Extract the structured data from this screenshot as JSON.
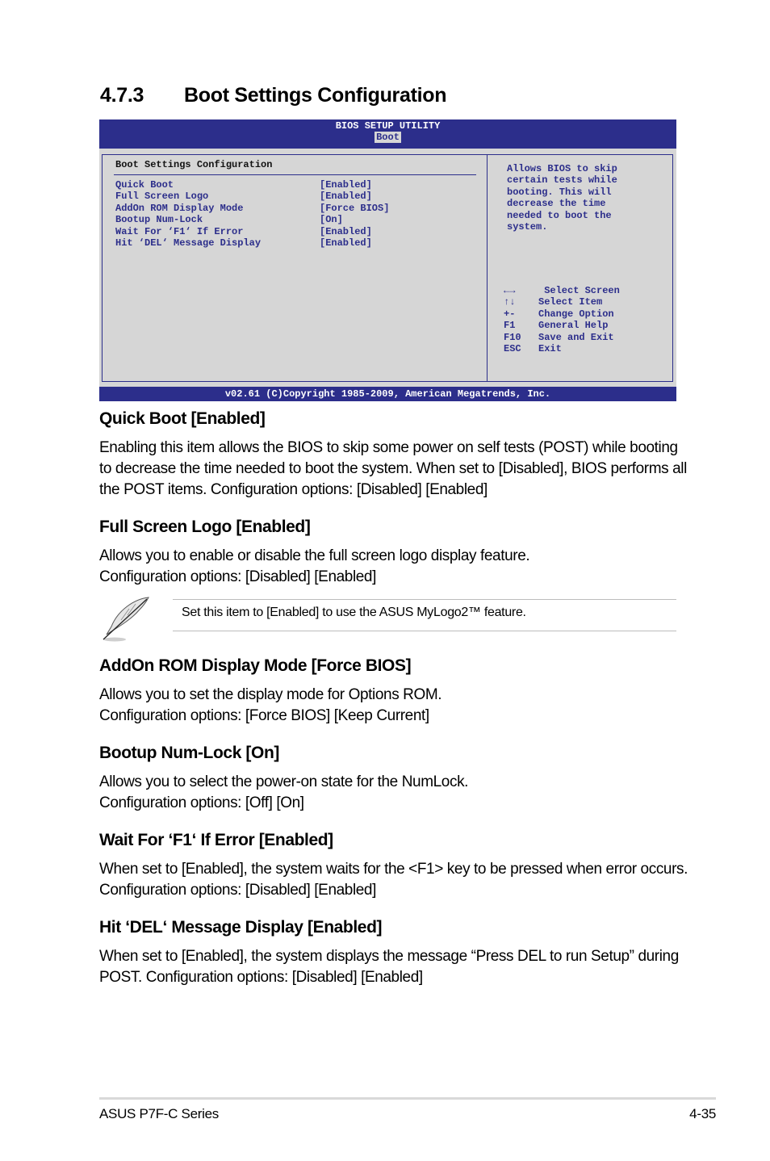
{
  "section": {
    "number": "4.7.3",
    "title": "Boot Settings Configuration"
  },
  "bios": {
    "header_title": "BIOS SETUP UTILITY",
    "active_tab": "Boot",
    "panel_title": "Boot Settings Configuration",
    "items": [
      {
        "label": "Quick Boot",
        "value": "[Enabled]"
      },
      {
        "label": "Full Screen Logo",
        "value": "[Enabled]"
      },
      {
        "label": "AddOn ROM Display Mode",
        "value": "[Force BIOS]"
      },
      {
        "label": "Bootup Num-Lock",
        "value": "[On]"
      },
      {
        "label": "Wait For ‘F1‘ If Error",
        "value": "[Enabled]"
      },
      {
        "label": "Hit ‘DEL‘ Message Display",
        "value": "[Enabled]"
      }
    ],
    "help_text": "Allows BIOS to skip\ncertain tests while\nbooting. This will\ndecrease the time\nneeded to boot the\nsystem.",
    "keys": [
      {
        "key": "←→",
        "action": " Select Screen"
      },
      {
        "key": "↑↓",
        "action": "Select Item"
      },
      {
        "key": "+-",
        "action": "Change Option"
      },
      {
        "key": "F1",
        "action": "General Help"
      },
      {
        "key": "F10",
        "action": "Save and Exit"
      },
      {
        "key": "ESC",
        "action": "Exit"
      }
    ],
    "footer": "v02.61 (C)Copyright 1985-2009, American Megatrends, Inc."
  },
  "descriptions": [
    {
      "heading": "Quick Boot [Enabled]",
      "text": "Enabling this item allows the BIOS to skip some power on self tests (POST) while booting to decrease the time needed to boot the system. When set to [Disabled], BIOS performs all the POST items. Configuration options: [Disabled] [Enabled]"
    },
    {
      "heading": "Full Screen Logo [Enabled]",
      "text": "Allows you to enable or disable the full screen logo display feature. Configuration options: [Disabled] [Enabled]"
    },
    {
      "heading": "AddOn ROM Display Mode [Force BIOS]",
      "text": "Allows you to set the display mode for Options ROM. Configuration options: [Force BIOS] [Keep Current]"
    },
    {
      "heading": "Bootup Num-Lock [On]",
      "text": "Allows you to select the power-on state for the NumLock. Configuration options: [Off] [On]"
    },
    {
      "heading": "Wait For ‘F1‘ If Error [Enabled]",
      "text": "When set to [Enabled], the system waits for the <F1> key to be pressed when error occurs. Configuration options: [Disabled] [Enabled]"
    },
    {
      "heading": "Hit ‘DEL‘ Message Display [Enabled]",
      "text": "When set to [Enabled], the system displays the message “Press DEL to run Setup” during POST. Configuration options: [Disabled] [Enabled]"
    }
  ],
  "note": {
    "icon": "feather-pen-icon",
    "text": "Set this item to [Enabled] to use the ASUS MyLogo2™ feature."
  },
  "footer": {
    "left": "ASUS P7F-C Series",
    "right": "4-35"
  }
}
